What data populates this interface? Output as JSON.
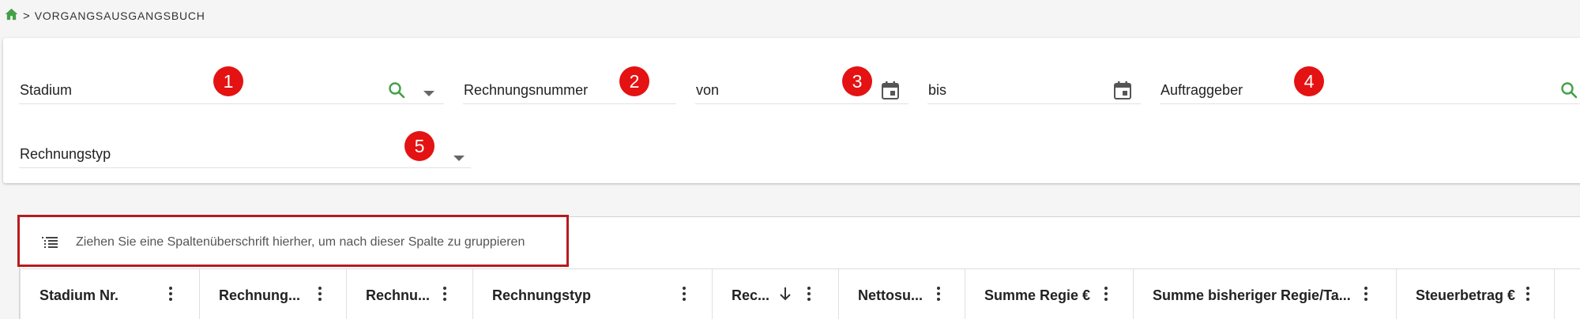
{
  "breadcrumb": {
    "home_icon": "home-icon",
    "separator": ">",
    "current": "VORGANGSAUSGANGSBUCH"
  },
  "filters": {
    "stadium": {
      "label": "Stadium",
      "badge": "1",
      "icons": [
        "search-icon",
        "dropdown-arrow-icon"
      ]
    },
    "rechnungsnummer": {
      "label": "Rechnungsnummer",
      "badge": "2"
    },
    "von": {
      "label": "von",
      "badge": "3",
      "icons": [
        "calendar-icon"
      ]
    },
    "bis": {
      "label": "bis",
      "icons": [
        "calendar-icon"
      ]
    },
    "auftraggeber": {
      "label": "Auftraggeber",
      "badge": "4",
      "icons": [
        "search-icon"
      ]
    },
    "rechnungstyp": {
      "label": "Rechnungstyp",
      "badge": "5",
      "icons": [
        "dropdown-arrow-icon"
      ]
    }
  },
  "grid": {
    "group_panel_text": "Ziehen Sie eine Spaltenüberschrift hierher, um nach dieser Spalte zu gruppieren",
    "columns": [
      {
        "label": "Stadium Nr."
      },
      {
        "label": "Rechnung..."
      },
      {
        "label": "Rechnu..."
      },
      {
        "label": "Rechnungstyp"
      },
      {
        "label": "Rec...",
        "sort": "descending"
      },
      {
        "label": "Nettosu..."
      },
      {
        "label": "Summe Regie €"
      },
      {
        "label": "Summe bisheriger Regie/Ta..."
      },
      {
        "label": "Steuerbetrag €"
      }
    ]
  },
  "colors": {
    "accent_green": "#43a047",
    "badge_red": "#e41212",
    "highlight_border": "#b71c1c"
  }
}
